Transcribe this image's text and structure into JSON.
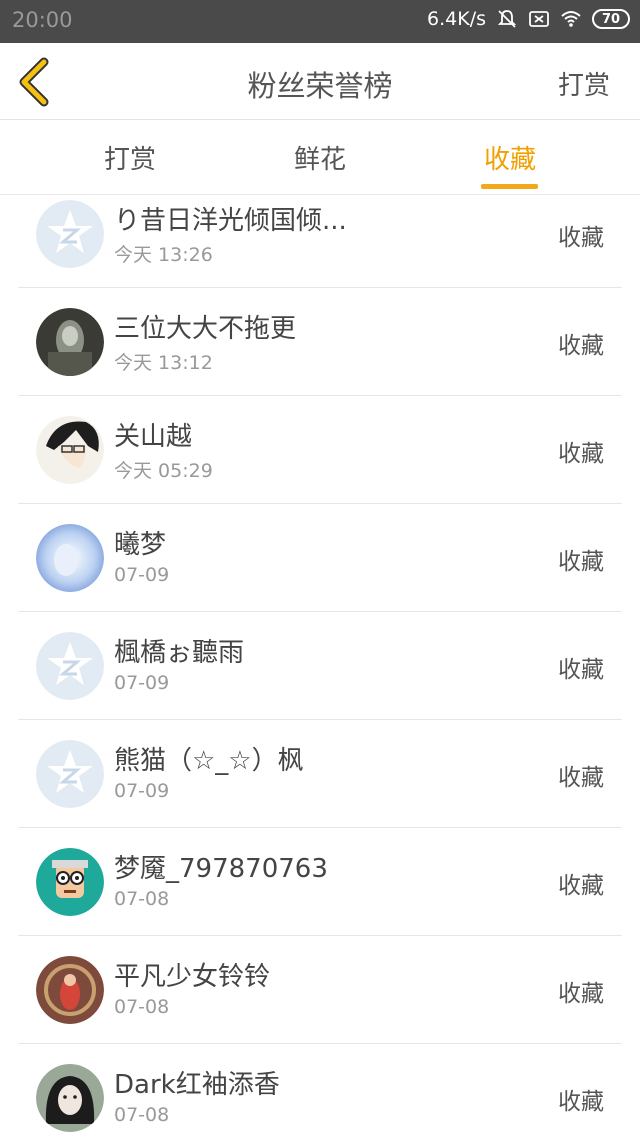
{
  "status": {
    "time": "20:00",
    "speed": "6.4K/s",
    "battery": "70"
  },
  "nav": {
    "title": "粉丝荣誉榜",
    "action": "打赏",
    "back_icon": "chevron-left-icon"
  },
  "tabs": [
    {
      "label": "打赏",
      "active": false
    },
    {
      "label": "鲜花",
      "active": false
    },
    {
      "label": "收藏",
      "active": true
    }
  ],
  "colors": {
    "accent": "#f3a81a",
    "statusbar": "#4a4a4a"
  },
  "items": [
    {
      "name": "り昔日洋光倾国倾...",
      "time": "今天 13:26",
      "label": "收藏",
      "avatar": "default-star"
    },
    {
      "name": "三位大大不拖更",
      "time": "今天 13:12",
      "label": "收藏",
      "avatar": "dark-photo"
    },
    {
      "name": "关山越",
      "time": "今天 05:29",
      "label": "收藏",
      "avatar": "anime-boy"
    },
    {
      "name": "曦梦",
      "time": "07-09",
      "label": "收藏",
      "avatar": "blue-anime"
    },
    {
      "name": "楓橋ぉ聽雨",
      "time": "07-09",
      "label": "收藏",
      "avatar": "default-star"
    },
    {
      "name": "熊猫（☆_☆）枫",
      "time": "07-09",
      "label": "收藏",
      "avatar": "default-star"
    },
    {
      "name": "梦魇_797870763",
      "time": "07-08",
      "label": "收藏",
      "avatar": "pixel-glasses"
    },
    {
      "name": "平凡少女铃铃",
      "time": "07-08",
      "label": "收藏",
      "avatar": "red-art"
    },
    {
      "name": "Dark红袖添香",
      "time": "07-08",
      "label": "收藏",
      "avatar": "dark-hair-girl"
    }
  ]
}
